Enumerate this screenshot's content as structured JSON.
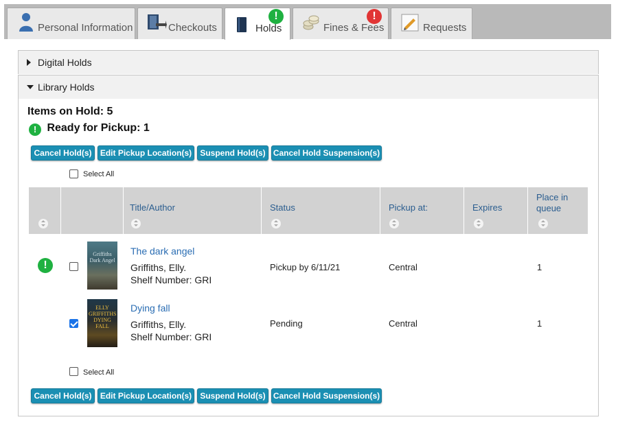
{
  "tabs": [
    {
      "label": "Personal Information",
      "icon": "person-icon"
    },
    {
      "label": "Checkouts",
      "icon": "checkout-icon"
    },
    {
      "label": "Holds",
      "icon": "book-icon",
      "badge": "!",
      "badge_color": "#1fb141",
      "active": true
    },
    {
      "label": "Fines & Fees",
      "icon": "coins-icon",
      "badge": "!",
      "badge_color": "#e13535"
    },
    {
      "label": "Requests",
      "icon": "pencil-icon"
    }
  ],
  "digital_holds": {
    "label": "Digital Holds"
  },
  "library_holds": {
    "label": "Library Holds",
    "items_on_hold": "Items on Hold: 5",
    "ready_for_pickup": "Ready for Pickup: 1",
    "select_all": "Select All",
    "actions": [
      "Cancel Hold(s)",
      "Edit Pickup Location(s)",
      "Suspend Hold(s)",
      "Cancel Hold Suspension(s)"
    ],
    "columns": [
      "Title/Author",
      "Status",
      "Pickup at:",
      "Expires",
      "Place in queue"
    ],
    "rows": [
      {
        "title": "The dark angel",
        "author": "Griffiths, Elly.",
        "shelf": "Shelf Number: GRI",
        "status": "Pickup by 6/11/21",
        "pickup_at": "Central",
        "expires": "",
        "place": "1",
        "ready": true,
        "checked": false,
        "cover_text": "Griffiths Dark Angel"
      },
      {
        "title": "Dying fall",
        "author": "Griffiths, Elly.",
        "shelf": "Shelf Number: GRI",
        "status": "Pending",
        "pickup_at": "Central",
        "expires": "",
        "place": "1",
        "ready": false,
        "checked": true,
        "cover_text": "ELLY GRIFFITHS DYING FALL"
      }
    ]
  },
  "colors": {
    "accent_button": "#1b8fb3",
    "ready_green": "#1fb141",
    "alert_red": "#e13535",
    "link": "#2a6db3",
    "header_bg": "#d2d2d2"
  }
}
